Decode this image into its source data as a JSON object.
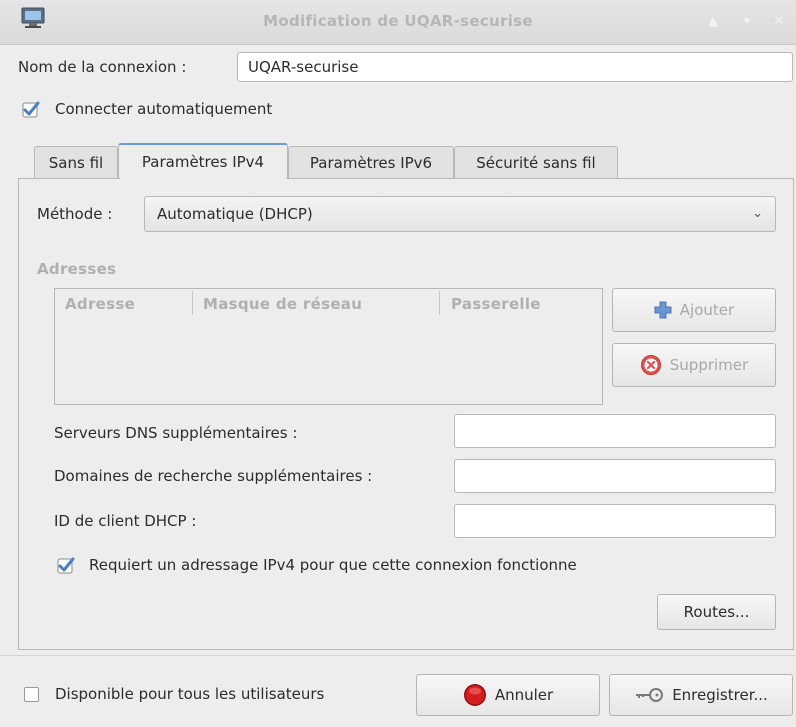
{
  "window": {
    "title": "Modification de UQAR-securise",
    "controls": [
      "▲",
      "✦",
      "✕"
    ]
  },
  "connection": {
    "name_label": "Nom de la connexion :",
    "name_value": "UQAR-securise",
    "auto_connect_label": "Connecter automatiquement",
    "auto_connect_checked": true
  },
  "tabs": [
    {
      "label": "Sans fil",
      "active": false
    },
    {
      "label": "Paramètres IPv4",
      "active": true
    },
    {
      "label": "Paramètres IPv6",
      "active": false
    },
    {
      "label": "Sécurité sans fil",
      "active": false
    }
  ],
  "ipv4": {
    "method_label": "Méthode :",
    "method_value": "Automatique (DHCP)",
    "addresses_heading": "Adresses",
    "columns": [
      "Adresse",
      "Masque de réseau",
      "Passerelle"
    ],
    "add_button": "Ajouter",
    "remove_button": "Supprimer",
    "dns_label": "Serveurs DNS supplémentaires :",
    "dns_value": "",
    "search_domains_label": "Domaines de recherche supplémentaires :",
    "search_domains_value": "",
    "dhcp_client_id_label": "ID de client DHCP :",
    "dhcp_client_id_value": "",
    "require_ipv4_label": "Requiert un adressage IPv4 pour que cette connexion fonctionne",
    "require_ipv4_checked": true,
    "routes_button": "Routes..."
  },
  "footer": {
    "all_users_label": "Disponible pour tous les utilisateurs",
    "all_users_checked": false,
    "cancel_button": "Annuler",
    "save_button": "Enregistrer..."
  },
  "colors": {
    "check_blue": "#4a7fc8",
    "cancel_red": "#d61d1d",
    "remove_red": "#e0524f",
    "add_blue": "#6a95cf",
    "active_tab_accent": "#6c9ad6"
  }
}
